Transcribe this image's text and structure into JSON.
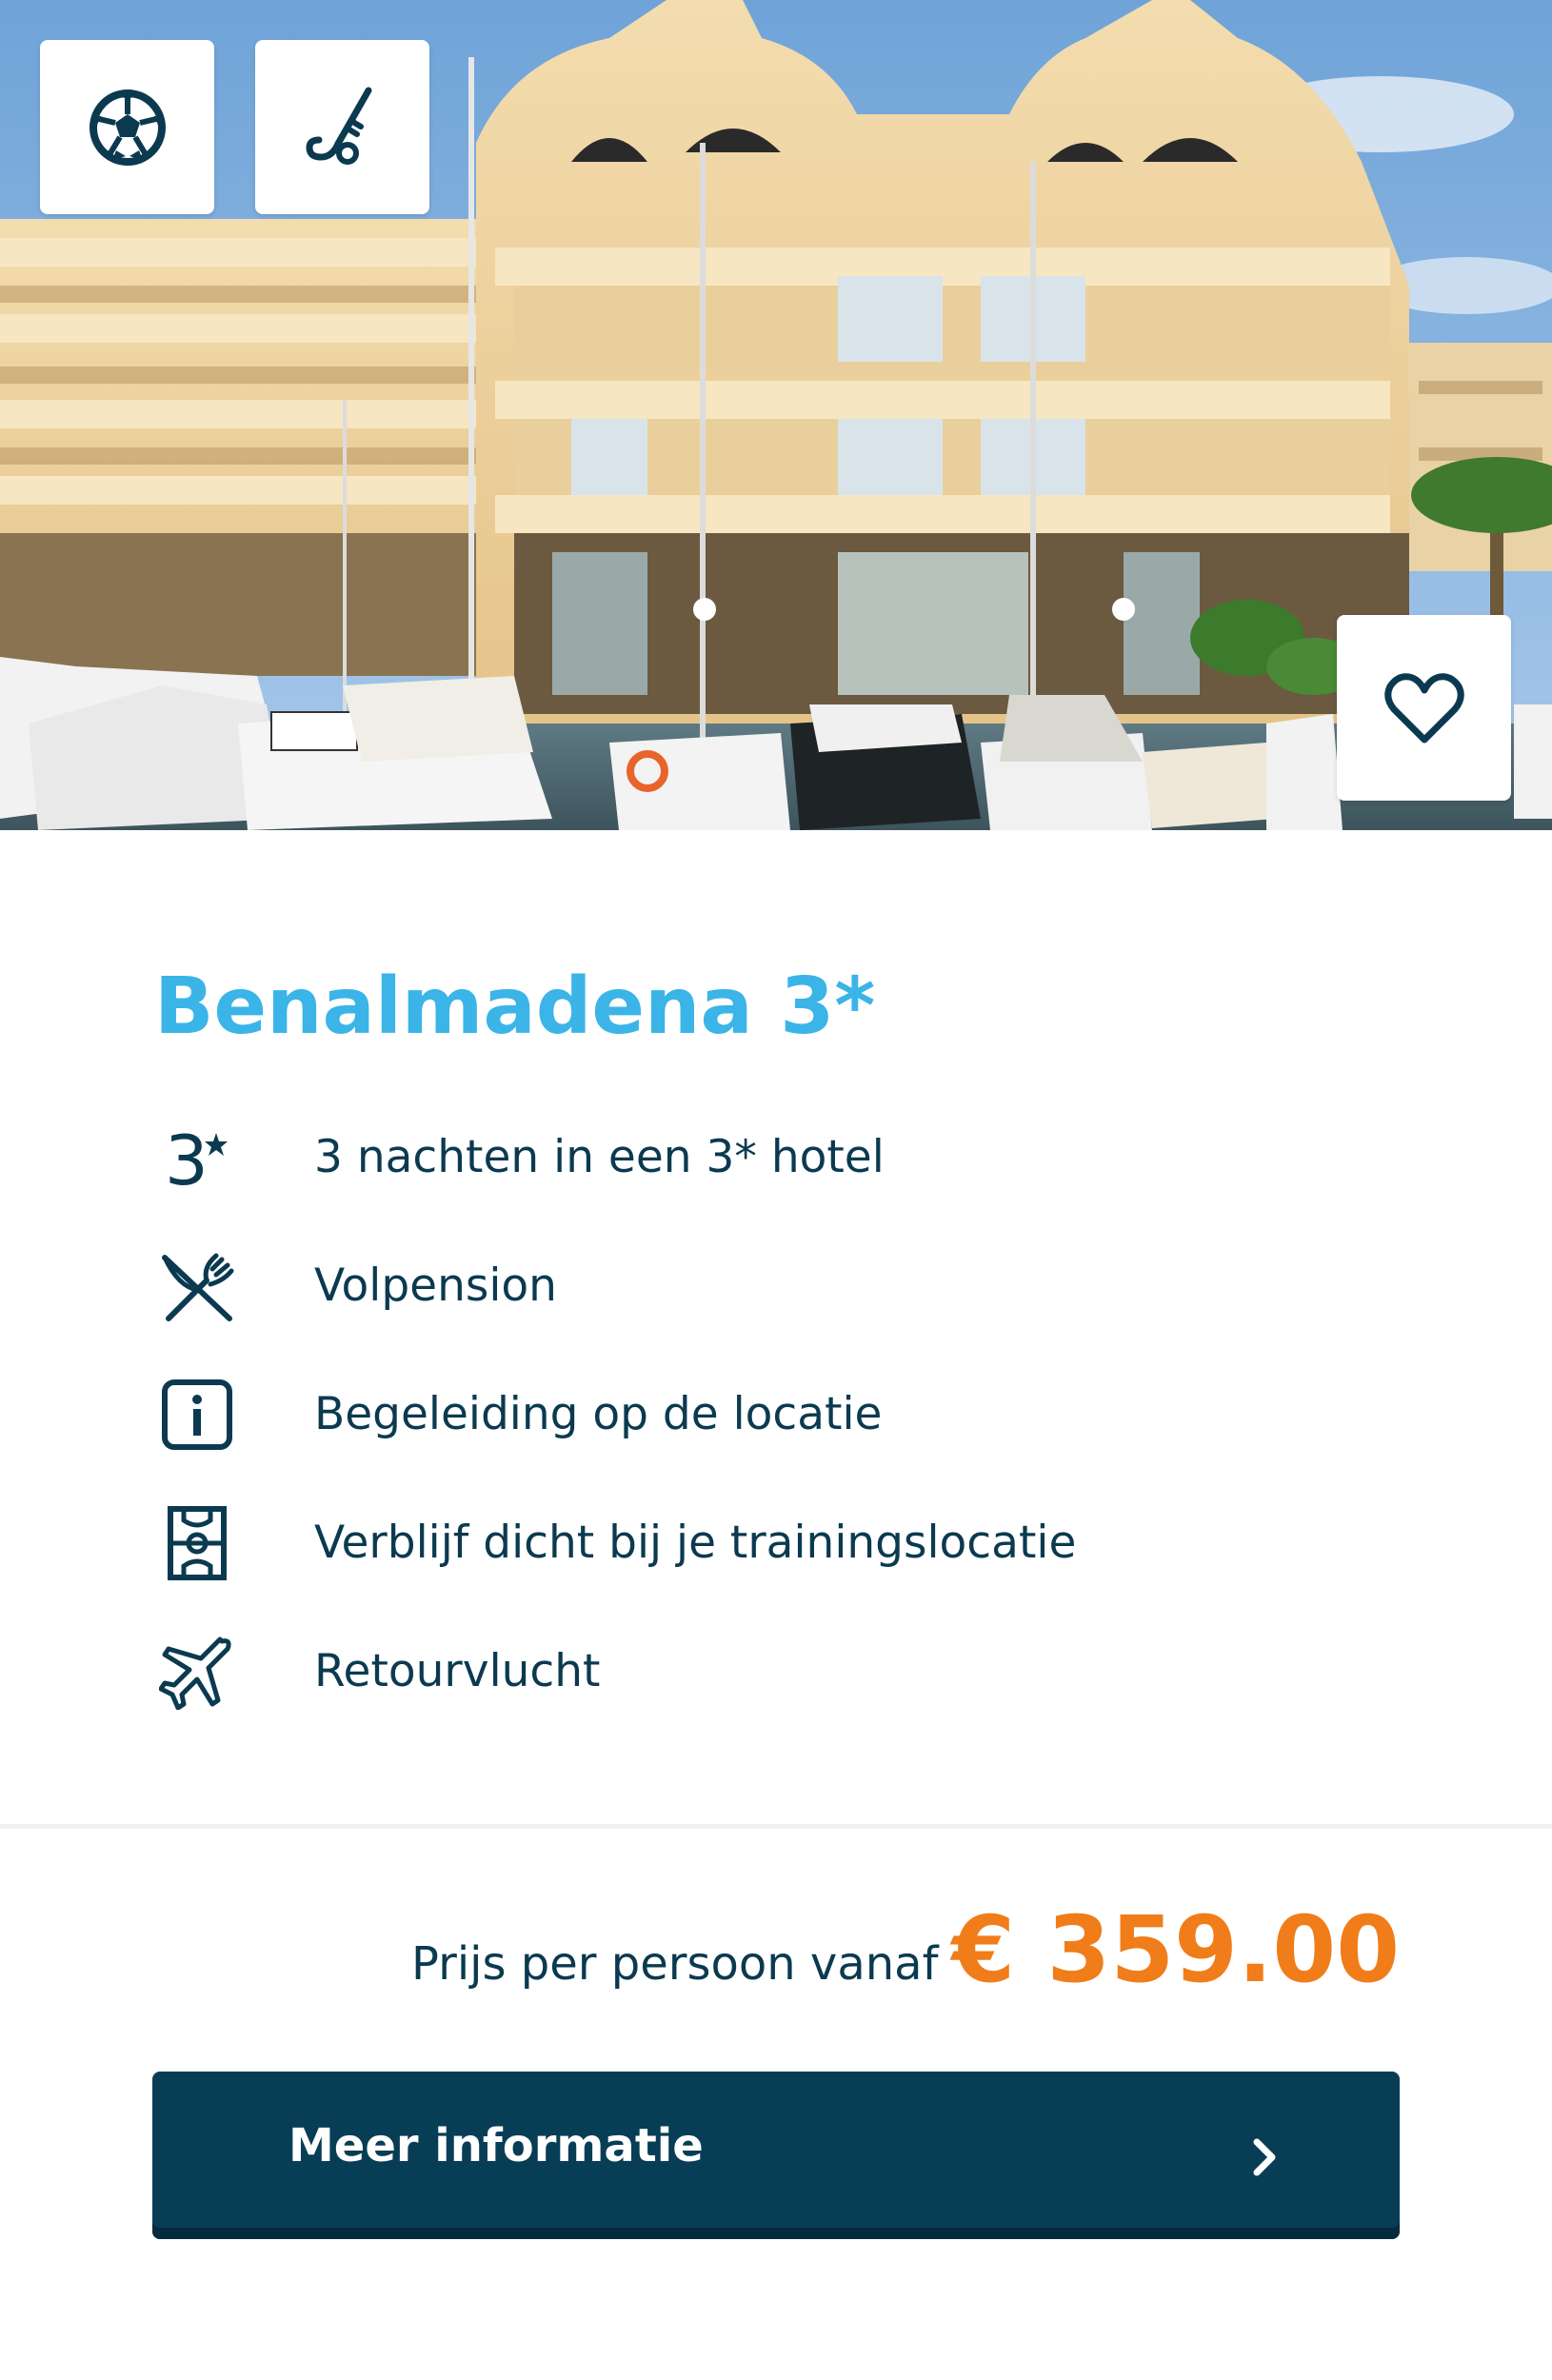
{
  "hero": {
    "sport_badges": [
      {
        "icon": "soccer-ball-icon"
      },
      {
        "icon": "field-hockey-icon"
      }
    ],
    "favorite": {
      "icon": "heart-icon"
    }
  },
  "offer": {
    "title": "Benalmadena 3*",
    "features": [
      {
        "icon": "three-star-icon",
        "label": "3 nachten in een 3* hotel"
      },
      {
        "icon": "cutlery-icon",
        "label": "Volpension"
      },
      {
        "icon": "info-icon",
        "label": "Begeleiding op de locatie"
      },
      {
        "icon": "sports-field-icon",
        "label": "Verblijf dicht bij je trainingslocatie"
      },
      {
        "icon": "airplane-icon",
        "label": "Retourvlucht"
      }
    ]
  },
  "price": {
    "label": "Prijs per persoon vanaf",
    "value": "€ 359.00"
  },
  "cta": {
    "label": "Meer informatie",
    "icon": "chevron-right-icon"
  },
  "colors": {
    "title": "#3bb4e7",
    "text": "#0b3a50",
    "price": "#f07d1a",
    "button": "#083d56"
  }
}
